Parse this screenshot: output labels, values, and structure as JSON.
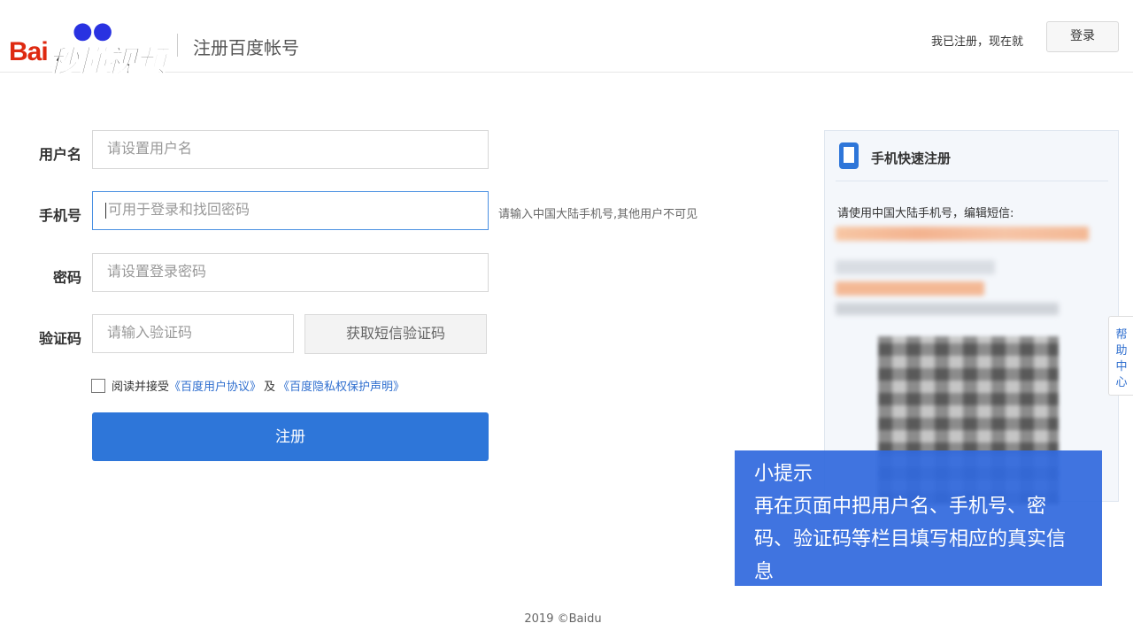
{
  "header": {
    "logo_text": "Bai",
    "watermark": "秒懂视频",
    "title": "注册百度帐号",
    "already_text": "我已注册，现在就",
    "login_label": "登录"
  },
  "form": {
    "username": {
      "label": "用户名",
      "placeholder": "请设置用户名"
    },
    "phone": {
      "label": "手机号",
      "placeholder": "可用于登录和找回密码",
      "hint": "请输入中国大陆手机号,其他用户不可见"
    },
    "password": {
      "label": "密码",
      "placeholder": "请设置登录密码"
    },
    "captcha": {
      "label": "验证码",
      "placeholder": "请输入验证码",
      "button": "获取短信验证码"
    },
    "agree": {
      "text": "阅读并接受",
      "link1": "《百度用户协议》",
      "and": "及",
      "link2": "《百度隐私权保护声明》"
    },
    "submit_label": "注册"
  },
  "panel": {
    "title": "手机快速注册",
    "instruction": "请使用中国大陆手机号，编辑短信:"
  },
  "help_tab": "帮助中心",
  "tip": {
    "title": "小提示",
    "body": "再在页面中把用户名、手机号、密码、验证码等栏目填写相应的真实信息"
  },
  "footer": "2019 ©Baidu"
}
